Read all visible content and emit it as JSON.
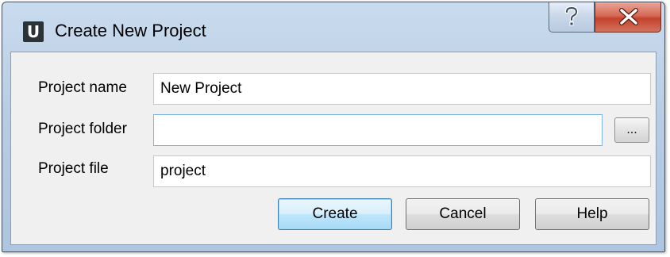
{
  "window": {
    "title": "Create New Project",
    "app_icon_letter": "U",
    "help_button": "question-mark-icon",
    "close_button": "close-icon"
  },
  "form": {
    "project_name": {
      "label": "Project name",
      "value": "New Project"
    },
    "project_folder": {
      "label": "Project folder",
      "value": "",
      "browse_label": "..."
    },
    "project_file": {
      "label": "Project file",
      "value": "project"
    }
  },
  "buttons": {
    "create": "Create",
    "cancel": "Cancel",
    "help": "Help"
  },
  "colors": {
    "titlebar": "#b8cde4",
    "close_button": "#c4432d",
    "default_button": "#bee6fd",
    "dialog_body": "#f0f0f0"
  }
}
